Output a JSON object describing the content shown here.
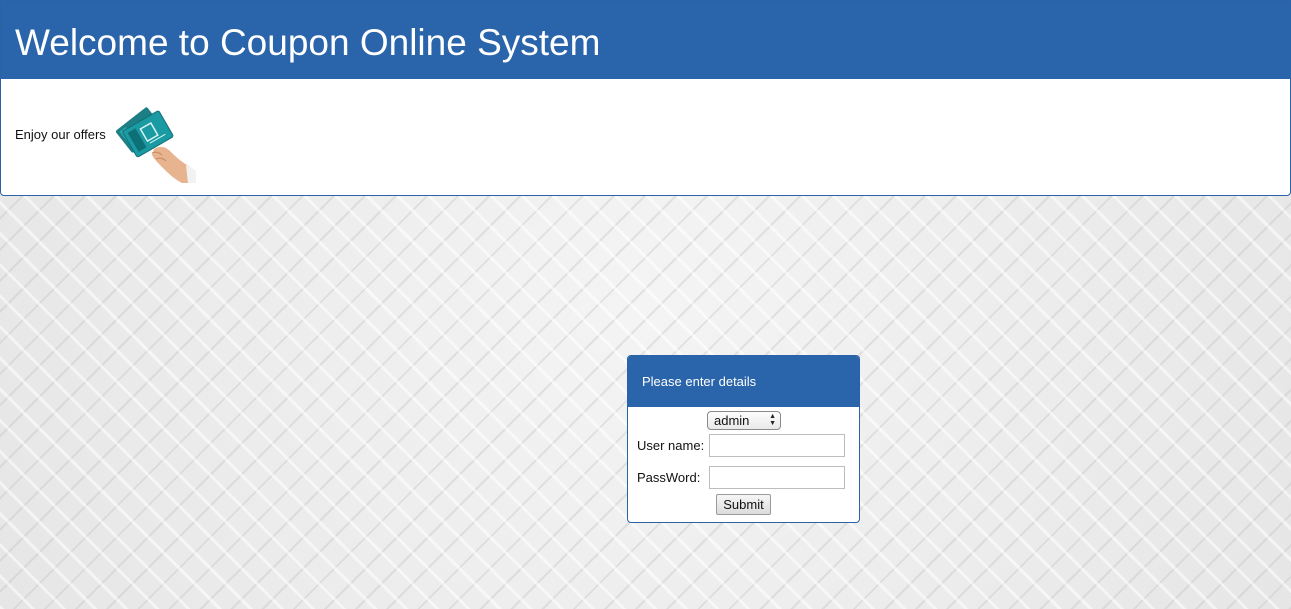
{
  "header": {
    "title": "Welcome to Coupon Online System",
    "tagline": "Enjoy our offers"
  },
  "offer_image": {
    "icon": "hand-holding-coupon-cards-icon"
  },
  "login": {
    "heading": "Please enter details",
    "role_select": {
      "selected": "admin",
      "icon": "up-down-arrows-icon"
    },
    "username_label": "User name:",
    "username_value": "",
    "password_label": "PassWord:",
    "password_value": "",
    "submit_label": "Submit"
  },
  "colors": {
    "brand_blue": "#2a64aa",
    "background": "#eeeeee"
  }
}
